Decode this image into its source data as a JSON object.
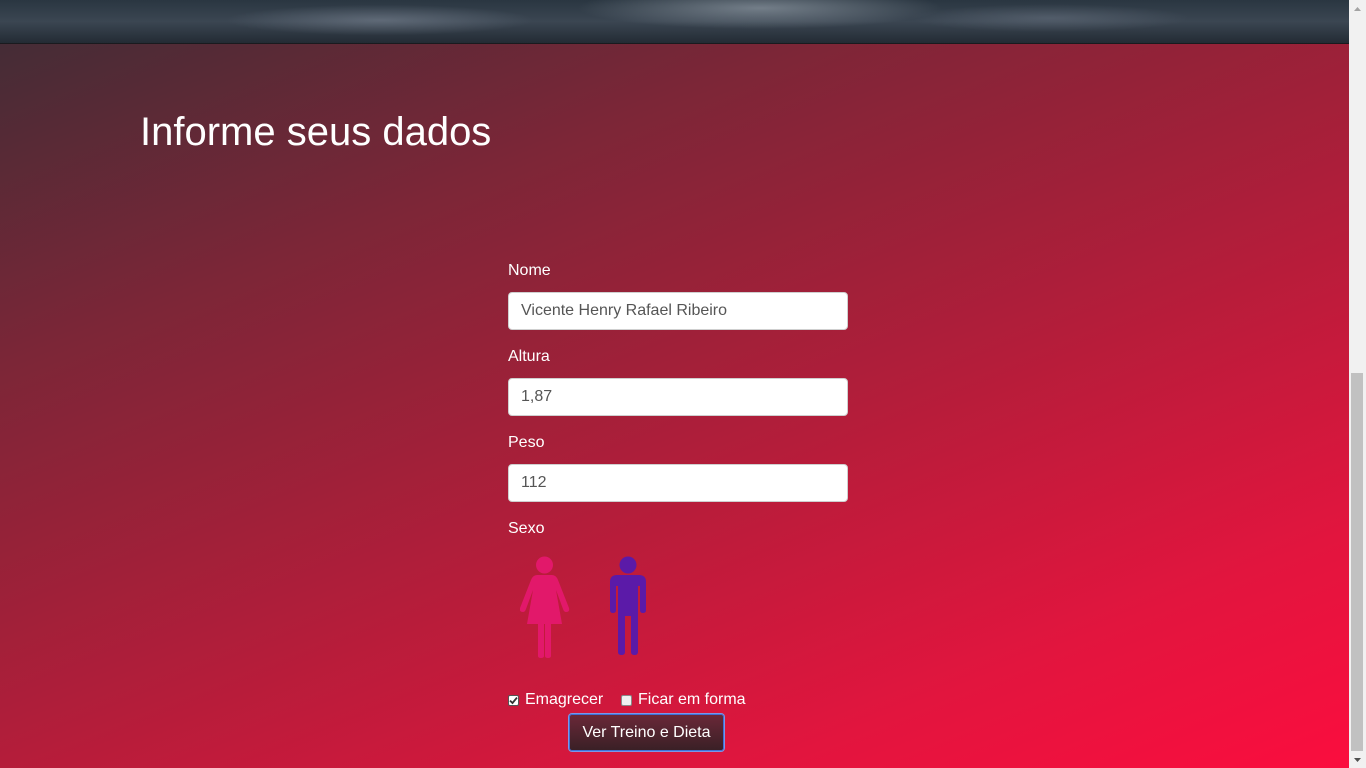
{
  "page": {
    "title": "Informe seus dados"
  },
  "form": {
    "name": {
      "label": "Nome",
      "value": "Vicente Henry Rafael Ribeiro"
    },
    "height": {
      "label": "Altura",
      "value": "1,87"
    },
    "weight": {
      "label": "Peso",
      "value": "112"
    },
    "sex": {
      "label": "Sexo",
      "options": [
        {
          "icon": "female-icon",
          "color": "#e2186a"
        },
        {
          "icon": "male-icon",
          "color": "#5b1aa8"
        }
      ]
    },
    "goals": [
      {
        "label": "Emagrecer",
        "checked": true
      },
      {
        "label": "Ficar em forma",
        "checked": false
      }
    ],
    "submit_label": "Ver Treino e Dieta"
  },
  "colors": {
    "gradient_start": "#3d2d36",
    "gradient_end": "#fb0d3e",
    "female": "#e2186a",
    "male": "#5b1aa8"
  }
}
